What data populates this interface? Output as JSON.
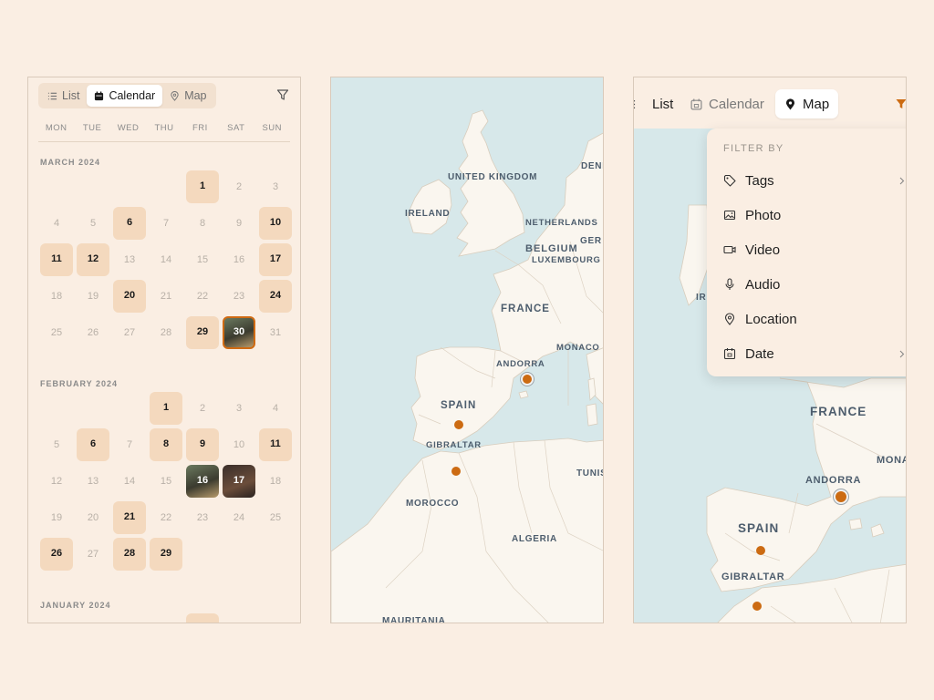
{
  "calendar_panel": {
    "tabs": [
      {
        "label": "List",
        "icon": "list-icon"
      },
      {
        "label": "Calendar",
        "icon": "calendar-icon",
        "active": true
      },
      {
        "label": "Map",
        "icon": "map-pin-icon"
      }
    ],
    "weekdays": [
      "MON",
      "TUE",
      "WED",
      "THU",
      "FRI",
      "SAT",
      "SUN"
    ],
    "months": [
      {
        "label": "MARCH 2024",
        "offset": 4,
        "days": 31,
        "has_entries": [
          1,
          6,
          10,
          11,
          12,
          17,
          20,
          24,
          29,
          30
        ],
        "photo_days": [
          30
        ],
        "selected": 30
      },
      {
        "label": "FEBRUARY 2024",
        "offset": 3,
        "days": 29,
        "has_entries": [
          1,
          6,
          8,
          9,
          11,
          16,
          17,
          21,
          26,
          28,
          29
        ],
        "photo_days": [
          16,
          17
        ],
        "selected": null
      },
      {
        "label": "JANUARY 2024"
      }
    ]
  },
  "map_panel": {
    "labels": [
      "UNITED KINGDOM",
      "IRELAND",
      "NETHERLANDS",
      "DENI",
      "BELGIUM",
      "GER",
      "LUXEMBOURG",
      "FRANCE",
      "MONACO",
      "ANDORRA",
      "SPAIN",
      "GIBRALTAR",
      "TUNIS",
      "MOROCCO",
      "ALGERIA",
      "MAURITANIA"
    ]
  },
  "map_panel_2": {
    "tabs": [
      {
        "label": "List",
        "icon": "list-icon"
      },
      {
        "label": "Calendar",
        "icon": "calendar-icon"
      },
      {
        "label": "Map",
        "icon": "map-pin-icon",
        "active": true
      }
    ],
    "filter": {
      "title": "FILTER BY",
      "items": [
        {
          "label": "Tags",
          "icon": "tag-icon",
          "chevron": true
        },
        {
          "label": "Photo",
          "icon": "photo-icon",
          "chevron": false
        },
        {
          "label": "Video",
          "icon": "video-icon",
          "chevron": false
        },
        {
          "label": "Audio",
          "icon": "microphone-icon",
          "chevron": false
        },
        {
          "label": "Location",
          "icon": "location-pin-icon",
          "chevron": false
        },
        {
          "label": "Date",
          "icon": "calendar-icon",
          "chevron": true
        }
      ]
    },
    "labels": [
      "IR",
      "FRANCE",
      "MONA",
      "ANDORRA",
      "SPAIN",
      "GIBRALTAR"
    ]
  },
  "accent_color": "#cc6b12"
}
